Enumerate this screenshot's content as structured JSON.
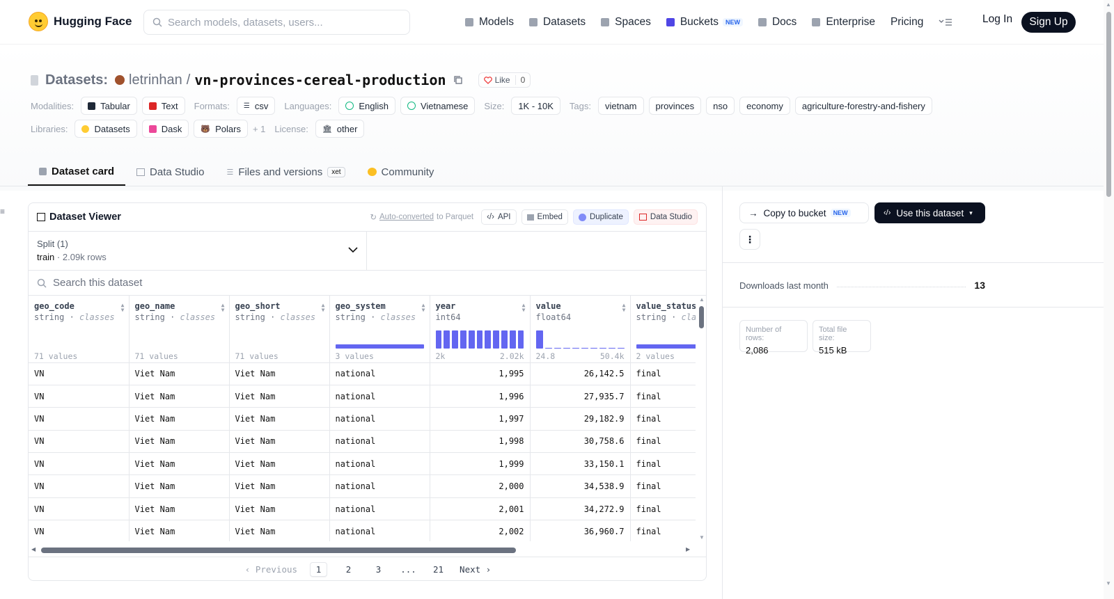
{
  "nav": {
    "brand": "Hugging Face",
    "search_placeholder": "Search models, datasets, users...",
    "links": [
      "Models",
      "Datasets",
      "Spaces",
      "Buckets",
      "Docs",
      "Enterprise",
      "Pricing"
    ],
    "new_badge": "NEW",
    "login": "Log In",
    "signup": "Sign Up"
  },
  "header": {
    "label": "Datasets:",
    "owner": "letrinhan",
    "slash": "/",
    "name": "vn-provinces-cereal-production",
    "like_label": "Like",
    "like_count": "0",
    "modalities_key": "Modalities:",
    "modalities": [
      "Tabular",
      "Text"
    ],
    "formats_key": "Formats:",
    "formats": [
      "csv"
    ],
    "languages_key": "Languages:",
    "languages": [
      "English",
      "Vietnamese"
    ],
    "size_key": "Size:",
    "size": "1K - 10K",
    "tags_key": "Tags:",
    "tags": [
      "vietnam",
      "provinces",
      "nso",
      "economy",
      "agriculture-forestry-and-fishery"
    ],
    "libraries_key": "Libraries:",
    "libraries": [
      "Datasets",
      "Dask",
      "Polars"
    ],
    "libraries_more": "+ 1",
    "license_key": "License:",
    "license": "other"
  },
  "tabs": [
    "Dataset card",
    "Data Studio",
    "Files and versions",
    "Community"
  ],
  "xet_badge": "xet",
  "viewer": {
    "title": "Dataset Viewer",
    "auto_link": "Auto-converted",
    "auto_suffix": "to Parquet",
    "buttons": [
      "API",
      "Embed",
      "Duplicate",
      "Data Studio"
    ],
    "split_label": "Split (1)",
    "split_name": "train",
    "split_rows": "2.09k rows",
    "search_placeholder": "Search this dataset",
    "columns": [
      {
        "name": "geo_code",
        "type": "string",
        "kind": "classes",
        "stat": "71 values"
      },
      {
        "name": "geo_name",
        "type": "string",
        "kind": "classes",
        "stat": "71 values"
      },
      {
        "name": "geo_short",
        "type": "string",
        "kind": "classes",
        "stat": "71 values"
      },
      {
        "name": "geo_system",
        "type": "string",
        "kind": "classes",
        "stat": "3 values"
      },
      {
        "name": "year",
        "type": "int64",
        "kind": "",
        "stat_min": "2k",
        "stat_max": "2.02k"
      },
      {
        "name": "value",
        "type": "float64",
        "kind": "",
        "stat_min": "24.8",
        "stat_max": "50.4k"
      },
      {
        "name": "value_status",
        "type": "string",
        "kind": "classes",
        "stat": "2 values"
      }
    ],
    "rows": [
      [
        "VN",
        "Viet Nam",
        "Viet Nam",
        "national",
        "1,995",
        "26,142.5",
        "final"
      ],
      [
        "VN",
        "Viet Nam",
        "Viet Nam",
        "national",
        "1,996",
        "27,935.7",
        "final"
      ],
      [
        "VN",
        "Viet Nam",
        "Viet Nam",
        "national",
        "1,997",
        "29,182.9",
        "final"
      ],
      [
        "VN",
        "Viet Nam",
        "Viet Nam",
        "national",
        "1,998",
        "30,758.6",
        "final"
      ],
      [
        "VN",
        "Viet Nam",
        "Viet Nam",
        "national",
        "1,999",
        "33,150.1",
        "final"
      ],
      [
        "VN",
        "Viet Nam",
        "Viet Nam",
        "national",
        "2,000",
        "34,538.9",
        "final"
      ],
      [
        "VN",
        "Viet Nam",
        "Viet Nam",
        "national",
        "2,001",
        "34,272.9",
        "final"
      ],
      [
        "VN",
        "Viet Nam",
        "Viet Nam",
        "national",
        "2,002",
        "36,960.7",
        "final"
      ]
    ],
    "pager": {
      "prev": "Previous",
      "pages": [
        "1",
        "2",
        "3",
        "...",
        "21"
      ],
      "next": "Next"
    }
  },
  "side": {
    "copy_label": "Copy to bucket",
    "use_label": "Use this dataset",
    "downloads_label": "Downloads last month",
    "downloads_value": "13",
    "rows_label": "Number of rows:",
    "rows_value": "2,086",
    "size_label": "Total file size:",
    "size_value": "515 kB"
  },
  "colors": {
    "accent": "#6366f1",
    "dark": "#0b1120",
    "like": "#ef4444"
  }
}
